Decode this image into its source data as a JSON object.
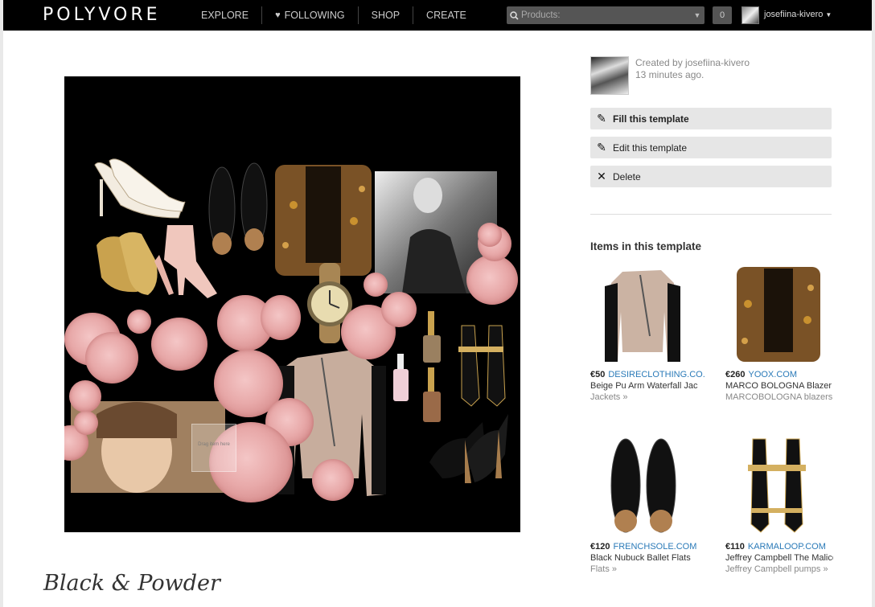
{
  "brand": "POLYVORE",
  "nav": {
    "explore": "EXPLORE",
    "following": "FOLLOWING",
    "shop": "SHOP",
    "create": "CREATE"
  },
  "search": {
    "placeholder": "Products:"
  },
  "cart_count": "0",
  "user": {
    "name": "josefiina-kivero"
  },
  "creator": {
    "line1": "Created by josefiina-kivero",
    "line2": "13 minutes ago."
  },
  "actions": {
    "fill": "Fill this template",
    "edit": "Edit this template",
    "delete": "Delete"
  },
  "canvas": {
    "drop_hint": "Drag item here"
  },
  "set_title": "Black & Powder",
  "items_heading": "Items in this template",
  "items": [
    {
      "price": "€50",
      "store": "DESIRECLOTHING.CO.",
      "name": "Beige Pu Arm Waterfall Jac",
      "category": "Jackets »"
    },
    {
      "price": "€260",
      "store": "YOOX.COM",
      "name": "MARCO BOLOGNA Blazer",
      "category": "MARCOBOLOGNA blazers"
    },
    {
      "price": "€120",
      "store": "FRENCHSOLE.COM",
      "name": "Black Nubuck Ballet Flats",
      "category": "Flats »"
    },
    {
      "price": "€110",
      "store": "KARMALOOP.COM",
      "name": "Jeffrey Campbell The Malice",
      "category": "Jeffrey Campbell pumps »"
    }
  ]
}
